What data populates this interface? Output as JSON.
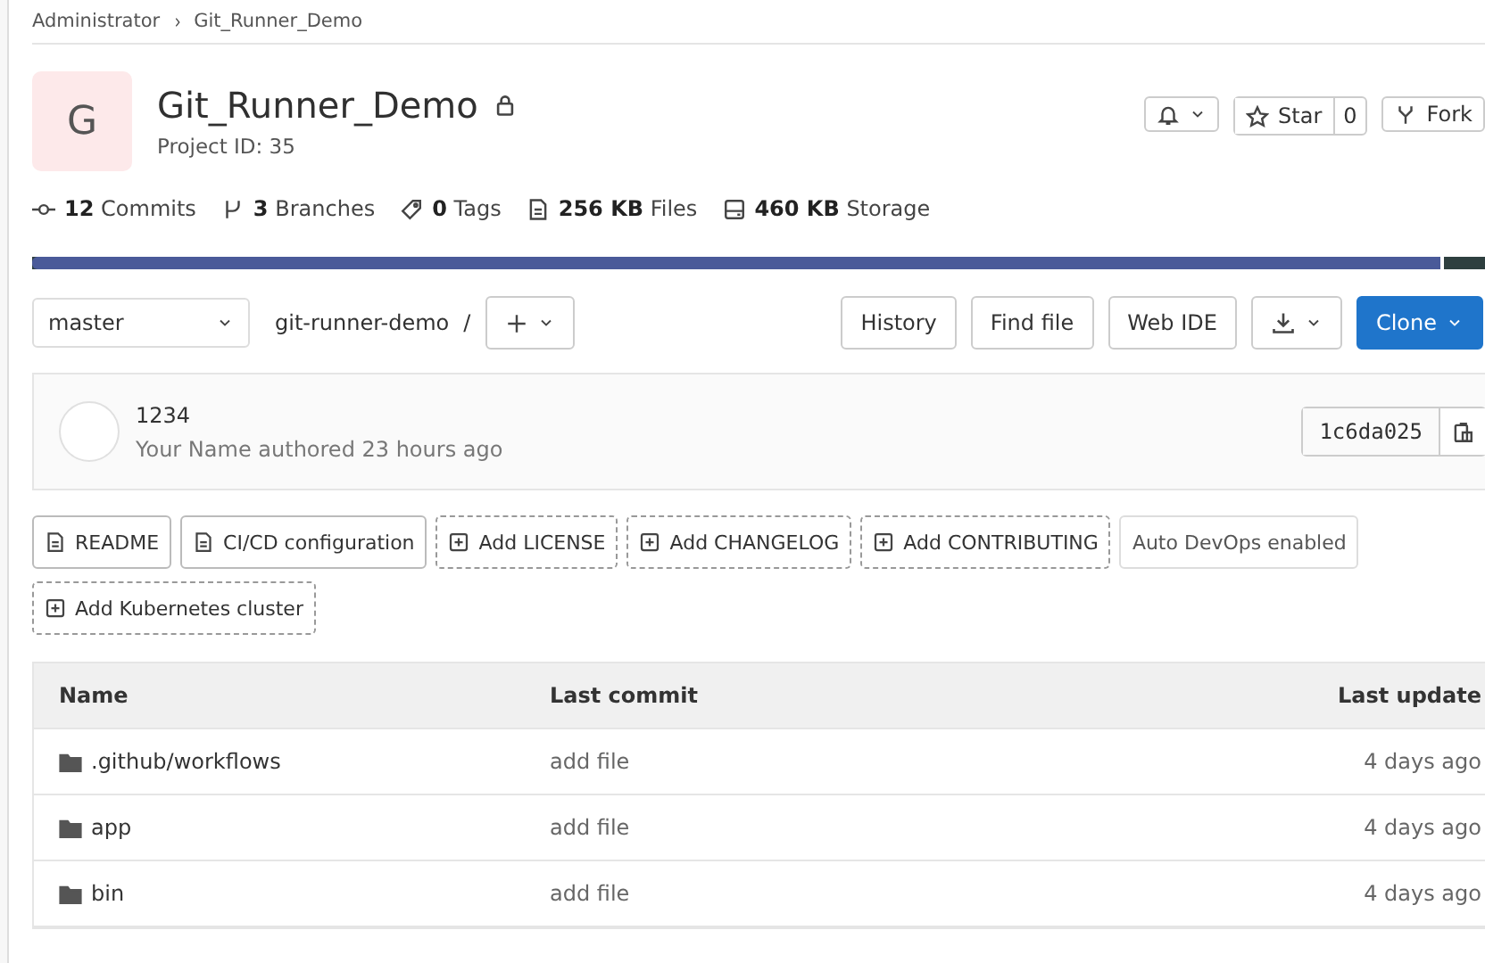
{
  "breadcrumbs": [
    "Administrator",
    "Git_Runner_Demo"
  ],
  "project": {
    "avatar_letter": "G",
    "name": "Git_Runner_Demo",
    "private": true,
    "project_id": "Project ID: 35"
  },
  "actions": [
    {
      "kind": "notify"
    },
    {
      "kind": "star",
      "label": "Star",
      "count": "0"
    },
    {
      "kind": "fork",
      "label": "Fork"
    }
  ],
  "stats": [
    {
      "kind": "commit",
      "value": "12",
      "label": "Commits"
    },
    {
      "kind": "branch",
      "value": "3",
      "label": "Branches"
    },
    {
      "kind": "tag",
      "value": "0",
      "label": "Tags"
    },
    {
      "kind": "file",
      "value": "256 KB",
      "label": "Files"
    },
    {
      "kind": "storage",
      "value": "460 KB",
      "label": "Storage"
    }
  ],
  "storage_bar": {
    "level": 0.964
  },
  "toolbar": {
    "branch": "master",
    "path": "git-runner-demo",
    "separator": "/",
    "buttons": [
      {
        "kind": "text",
        "label": "History"
      },
      {
        "kind": "text",
        "label": "Find file"
      },
      {
        "kind": "text",
        "label": "Web IDE"
      },
      {
        "kind": "download"
      },
      {
        "kind": "primary",
        "label": "Clone"
      }
    ]
  },
  "last_commit": {
    "message": "1234",
    "author": "Your Name authored 23 hours ago",
    "sha": "1c6da025"
  },
  "shortcuts": [
    {
      "kind": "file",
      "label": "README"
    },
    {
      "kind": "file",
      "label": "CI/CD configuration"
    },
    {
      "kind": "add",
      "label": "Add LICENSE"
    },
    {
      "kind": "add",
      "label": "Add CHANGELOG"
    },
    {
      "kind": "add",
      "label": "Add CONTRIBUTING"
    },
    {
      "kind": "plain",
      "label": "Auto DevOps enabled"
    },
    {
      "kind": "add",
      "label": "Add Kubernetes cluster"
    }
  ],
  "table": {
    "columns": [
      "Name",
      "Last commit",
      "Last update"
    ],
    "rows": [
      {
        "name": ".github/workflows",
        "commit": "add file",
        "updated": "4 days ago"
      },
      {
        "name": "app",
        "commit": "add file",
        "updated": "4 days ago"
      },
      {
        "name": "bin",
        "commit": "add file",
        "updated": "4 days ago"
      }
    ]
  }
}
